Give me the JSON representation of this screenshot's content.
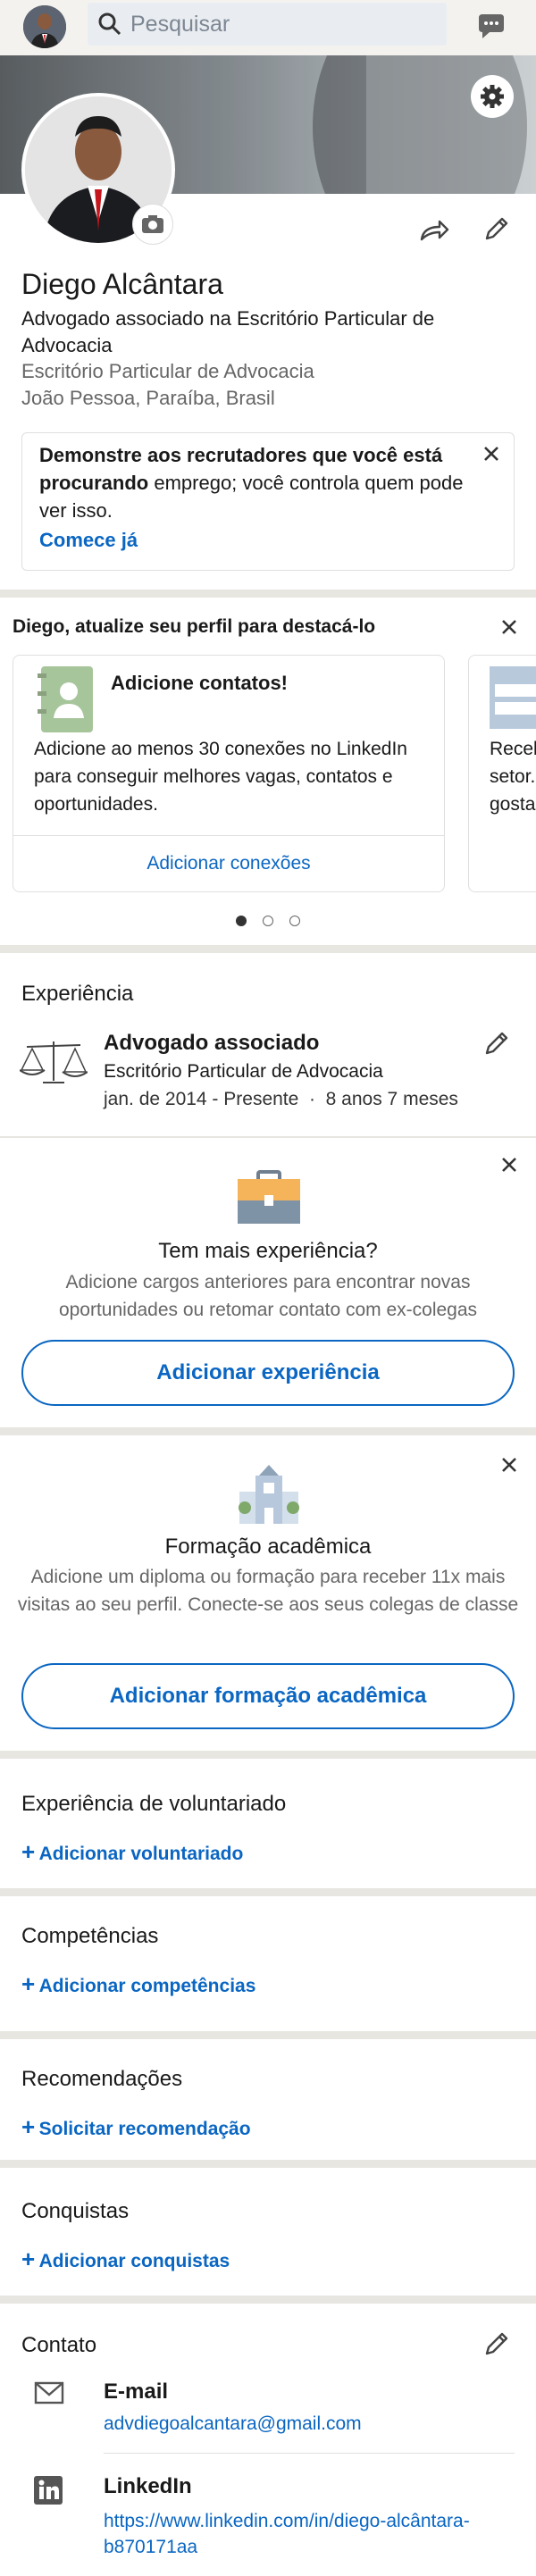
{
  "header": {
    "search_placeholder": "Pesquisar"
  },
  "profile": {
    "name": "Diego Alcântara",
    "headline": "Advogado associado na Escritório Particular de Advocacia",
    "company": "Escritório Particular de Advocacia",
    "location": "João Pessoa, Paraíba, Brasil"
  },
  "open_to_work": {
    "bold": "Demonstre aos recrutadores que você está procurando",
    "rest": " emprego; você controla quem pode ver isso.",
    "cta": "Comece já"
  },
  "suggestions": {
    "title": "Diego, atualize seu perfil para destacá-lo",
    "card1": {
      "title": "Adicione contatos!",
      "body": "Adicione ao menos 30 conexões no LinkedIn para conseguir melhores vagas, contatos e oportunidades.",
      "action": "Adicionar conexões"
    },
    "card2_partial": [
      "Receb",
      "setor.",
      "gosta"
    ],
    "dots": 3,
    "active_dot": 0
  },
  "experience": {
    "title": "Experiência",
    "role": "Advogado associado",
    "company": "Escritório Particular de Advocacia",
    "dates": "jan. de 2014 - Presente",
    "separator": "·",
    "duration": "8 anos 7 meses"
  },
  "more_experience": {
    "title": "Tem mais experiência?",
    "body": "Adicione cargos anteriores para encontrar novas oportunidades ou retomar contato com ex-colegas",
    "action": "Adicionar experiência"
  },
  "education": {
    "title": "Formação acadêmica",
    "body": "Adicione um diploma ou formação para receber 11x mais visitas ao seu perfil. Conecte-se aos seus colegas de classe",
    "action": "Adicionar formação acadêmica"
  },
  "volunteer": {
    "title": "Experiência de voluntariado",
    "action": "Adicionar voluntariado"
  },
  "skills": {
    "title": "Competências",
    "action": "Adicionar competências"
  },
  "recommendations": {
    "title": "Recomendações",
    "action": "Solicitar recomendação"
  },
  "achievements": {
    "title": "Conquistas",
    "action": "Adicionar conquistas"
  },
  "contact": {
    "title": "Contato",
    "email_label": "E-mail",
    "email": "advdiegoalcantara@gmail.com",
    "linkedin_label": "LinkedIn",
    "linkedin_line1": "https://www.linkedin.com/in/diego-alcântara-",
    "linkedin_line2": "b870171aa"
  },
  "colors": {
    "accent": "#0a66c2",
    "separator": "#e8e6e1",
    "muted": "#666666"
  }
}
